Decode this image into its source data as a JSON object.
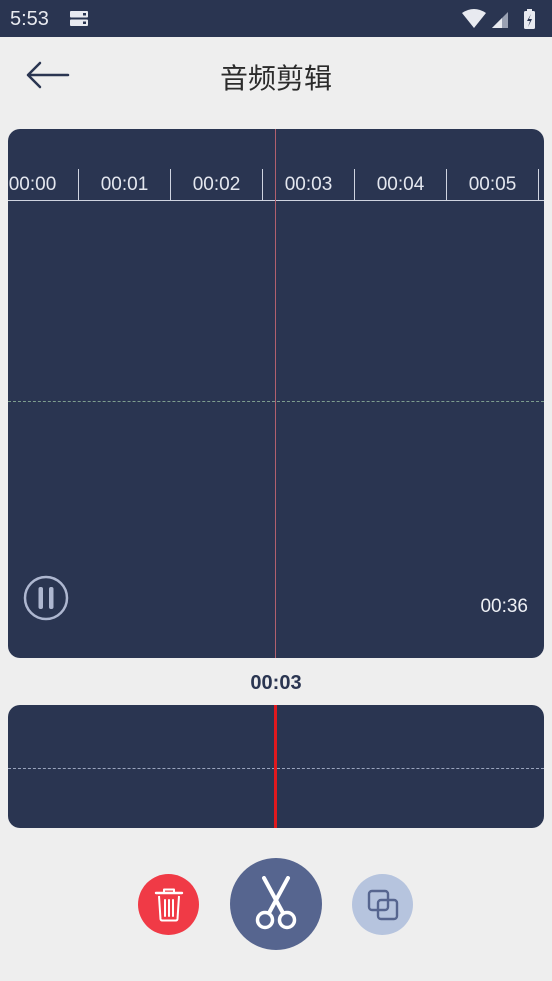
{
  "status_bar": {
    "time": "5:53"
  },
  "header": {
    "title": "音频剪辑"
  },
  "waveform": {
    "ticks": [
      "00:00",
      "00:01",
      "00:02",
      "00:03",
      "00:04",
      "00:05"
    ],
    "duration": "00:36"
  },
  "current_time": "00:03",
  "colors": {
    "panel": "#2a3551",
    "delete": "#f03a46",
    "cut": "#56658f",
    "copy": "#b6c4de",
    "playhead": "#e0191e"
  },
  "icons": {
    "back": "arrow-left-icon",
    "pause": "pause-icon",
    "delete": "trash-icon",
    "cut": "scissors-icon",
    "copy": "copy-icon"
  }
}
